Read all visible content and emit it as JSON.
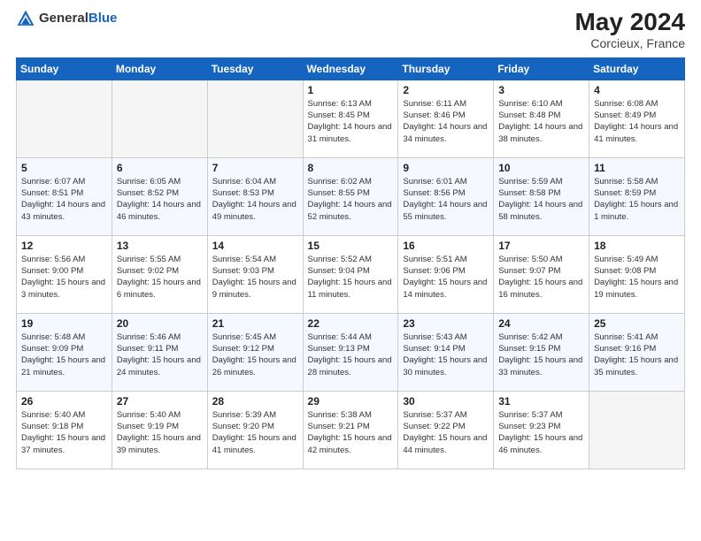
{
  "header": {
    "logo_line1": "General",
    "logo_line2": "Blue",
    "month_year": "May 2024",
    "location": "Corcieux, France"
  },
  "days_of_week": [
    "Sunday",
    "Monday",
    "Tuesday",
    "Wednesday",
    "Thursday",
    "Friday",
    "Saturday"
  ],
  "weeks": [
    [
      {
        "day": "",
        "sunrise": "",
        "sunset": "",
        "daylight": "",
        "empty": true
      },
      {
        "day": "",
        "sunrise": "",
        "sunset": "",
        "daylight": "",
        "empty": true
      },
      {
        "day": "",
        "sunrise": "",
        "sunset": "",
        "daylight": "",
        "empty": true
      },
      {
        "day": "1",
        "sunrise": "Sunrise: 6:13 AM",
        "sunset": "Sunset: 8:45 PM",
        "daylight": "Daylight: 14 hours and 31 minutes."
      },
      {
        "day": "2",
        "sunrise": "Sunrise: 6:11 AM",
        "sunset": "Sunset: 8:46 PM",
        "daylight": "Daylight: 14 hours and 34 minutes."
      },
      {
        "day": "3",
        "sunrise": "Sunrise: 6:10 AM",
        "sunset": "Sunset: 8:48 PM",
        "daylight": "Daylight: 14 hours and 38 minutes."
      },
      {
        "day": "4",
        "sunrise": "Sunrise: 6:08 AM",
        "sunset": "Sunset: 8:49 PM",
        "daylight": "Daylight: 14 hours and 41 minutes."
      }
    ],
    [
      {
        "day": "5",
        "sunrise": "Sunrise: 6:07 AM",
        "sunset": "Sunset: 8:51 PM",
        "daylight": "Daylight: 14 hours and 43 minutes."
      },
      {
        "day": "6",
        "sunrise": "Sunrise: 6:05 AM",
        "sunset": "Sunset: 8:52 PM",
        "daylight": "Daylight: 14 hours and 46 minutes."
      },
      {
        "day": "7",
        "sunrise": "Sunrise: 6:04 AM",
        "sunset": "Sunset: 8:53 PM",
        "daylight": "Daylight: 14 hours and 49 minutes."
      },
      {
        "day": "8",
        "sunrise": "Sunrise: 6:02 AM",
        "sunset": "Sunset: 8:55 PM",
        "daylight": "Daylight: 14 hours and 52 minutes."
      },
      {
        "day": "9",
        "sunrise": "Sunrise: 6:01 AM",
        "sunset": "Sunset: 8:56 PM",
        "daylight": "Daylight: 14 hours and 55 minutes."
      },
      {
        "day": "10",
        "sunrise": "Sunrise: 5:59 AM",
        "sunset": "Sunset: 8:58 PM",
        "daylight": "Daylight: 14 hours and 58 minutes."
      },
      {
        "day": "11",
        "sunrise": "Sunrise: 5:58 AM",
        "sunset": "Sunset: 8:59 PM",
        "daylight": "Daylight: 15 hours and 1 minute."
      }
    ],
    [
      {
        "day": "12",
        "sunrise": "Sunrise: 5:56 AM",
        "sunset": "Sunset: 9:00 PM",
        "daylight": "Daylight: 15 hours and 3 minutes."
      },
      {
        "day": "13",
        "sunrise": "Sunrise: 5:55 AM",
        "sunset": "Sunset: 9:02 PM",
        "daylight": "Daylight: 15 hours and 6 minutes."
      },
      {
        "day": "14",
        "sunrise": "Sunrise: 5:54 AM",
        "sunset": "Sunset: 9:03 PM",
        "daylight": "Daylight: 15 hours and 9 minutes."
      },
      {
        "day": "15",
        "sunrise": "Sunrise: 5:52 AM",
        "sunset": "Sunset: 9:04 PM",
        "daylight": "Daylight: 15 hours and 11 minutes."
      },
      {
        "day": "16",
        "sunrise": "Sunrise: 5:51 AM",
        "sunset": "Sunset: 9:06 PM",
        "daylight": "Daylight: 15 hours and 14 minutes."
      },
      {
        "day": "17",
        "sunrise": "Sunrise: 5:50 AM",
        "sunset": "Sunset: 9:07 PM",
        "daylight": "Daylight: 15 hours and 16 minutes."
      },
      {
        "day": "18",
        "sunrise": "Sunrise: 5:49 AM",
        "sunset": "Sunset: 9:08 PM",
        "daylight": "Daylight: 15 hours and 19 minutes."
      }
    ],
    [
      {
        "day": "19",
        "sunrise": "Sunrise: 5:48 AM",
        "sunset": "Sunset: 9:09 PM",
        "daylight": "Daylight: 15 hours and 21 minutes."
      },
      {
        "day": "20",
        "sunrise": "Sunrise: 5:46 AM",
        "sunset": "Sunset: 9:11 PM",
        "daylight": "Daylight: 15 hours and 24 minutes."
      },
      {
        "day": "21",
        "sunrise": "Sunrise: 5:45 AM",
        "sunset": "Sunset: 9:12 PM",
        "daylight": "Daylight: 15 hours and 26 minutes."
      },
      {
        "day": "22",
        "sunrise": "Sunrise: 5:44 AM",
        "sunset": "Sunset: 9:13 PM",
        "daylight": "Daylight: 15 hours and 28 minutes."
      },
      {
        "day": "23",
        "sunrise": "Sunrise: 5:43 AM",
        "sunset": "Sunset: 9:14 PM",
        "daylight": "Daylight: 15 hours and 30 minutes."
      },
      {
        "day": "24",
        "sunrise": "Sunrise: 5:42 AM",
        "sunset": "Sunset: 9:15 PM",
        "daylight": "Daylight: 15 hours and 33 minutes."
      },
      {
        "day": "25",
        "sunrise": "Sunrise: 5:41 AM",
        "sunset": "Sunset: 9:16 PM",
        "daylight": "Daylight: 15 hours and 35 minutes."
      }
    ],
    [
      {
        "day": "26",
        "sunrise": "Sunrise: 5:40 AM",
        "sunset": "Sunset: 9:18 PM",
        "daylight": "Daylight: 15 hours and 37 minutes."
      },
      {
        "day": "27",
        "sunrise": "Sunrise: 5:40 AM",
        "sunset": "Sunset: 9:19 PM",
        "daylight": "Daylight: 15 hours and 39 minutes."
      },
      {
        "day": "28",
        "sunrise": "Sunrise: 5:39 AM",
        "sunset": "Sunset: 9:20 PM",
        "daylight": "Daylight: 15 hours and 41 minutes."
      },
      {
        "day": "29",
        "sunrise": "Sunrise: 5:38 AM",
        "sunset": "Sunset: 9:21 PM",
        "daylight": "Daylight: 15 hours and 42 minutes."
      },
      {
        "day": "30",
        "sunrise": "Sunrise: 5:37 AM",
        "sunset": "Sunset: 9:22 PM",
        "daylight": "Daylight: 15 hours and 44 minutes."
      },
      {
        "day": "31",
        "sunrise": "Sunrise: 5:37 AM",
        "sunset": "Sunset: 9:23 PM",
        "daylight": "Daylight: 15 hours and 46 minutes."
      },
      {
        "day": "",
        "sunrise": "",
        "sunset": "",
        "daylight": "",
        "empty": true
      }
    ]
  ]
}
